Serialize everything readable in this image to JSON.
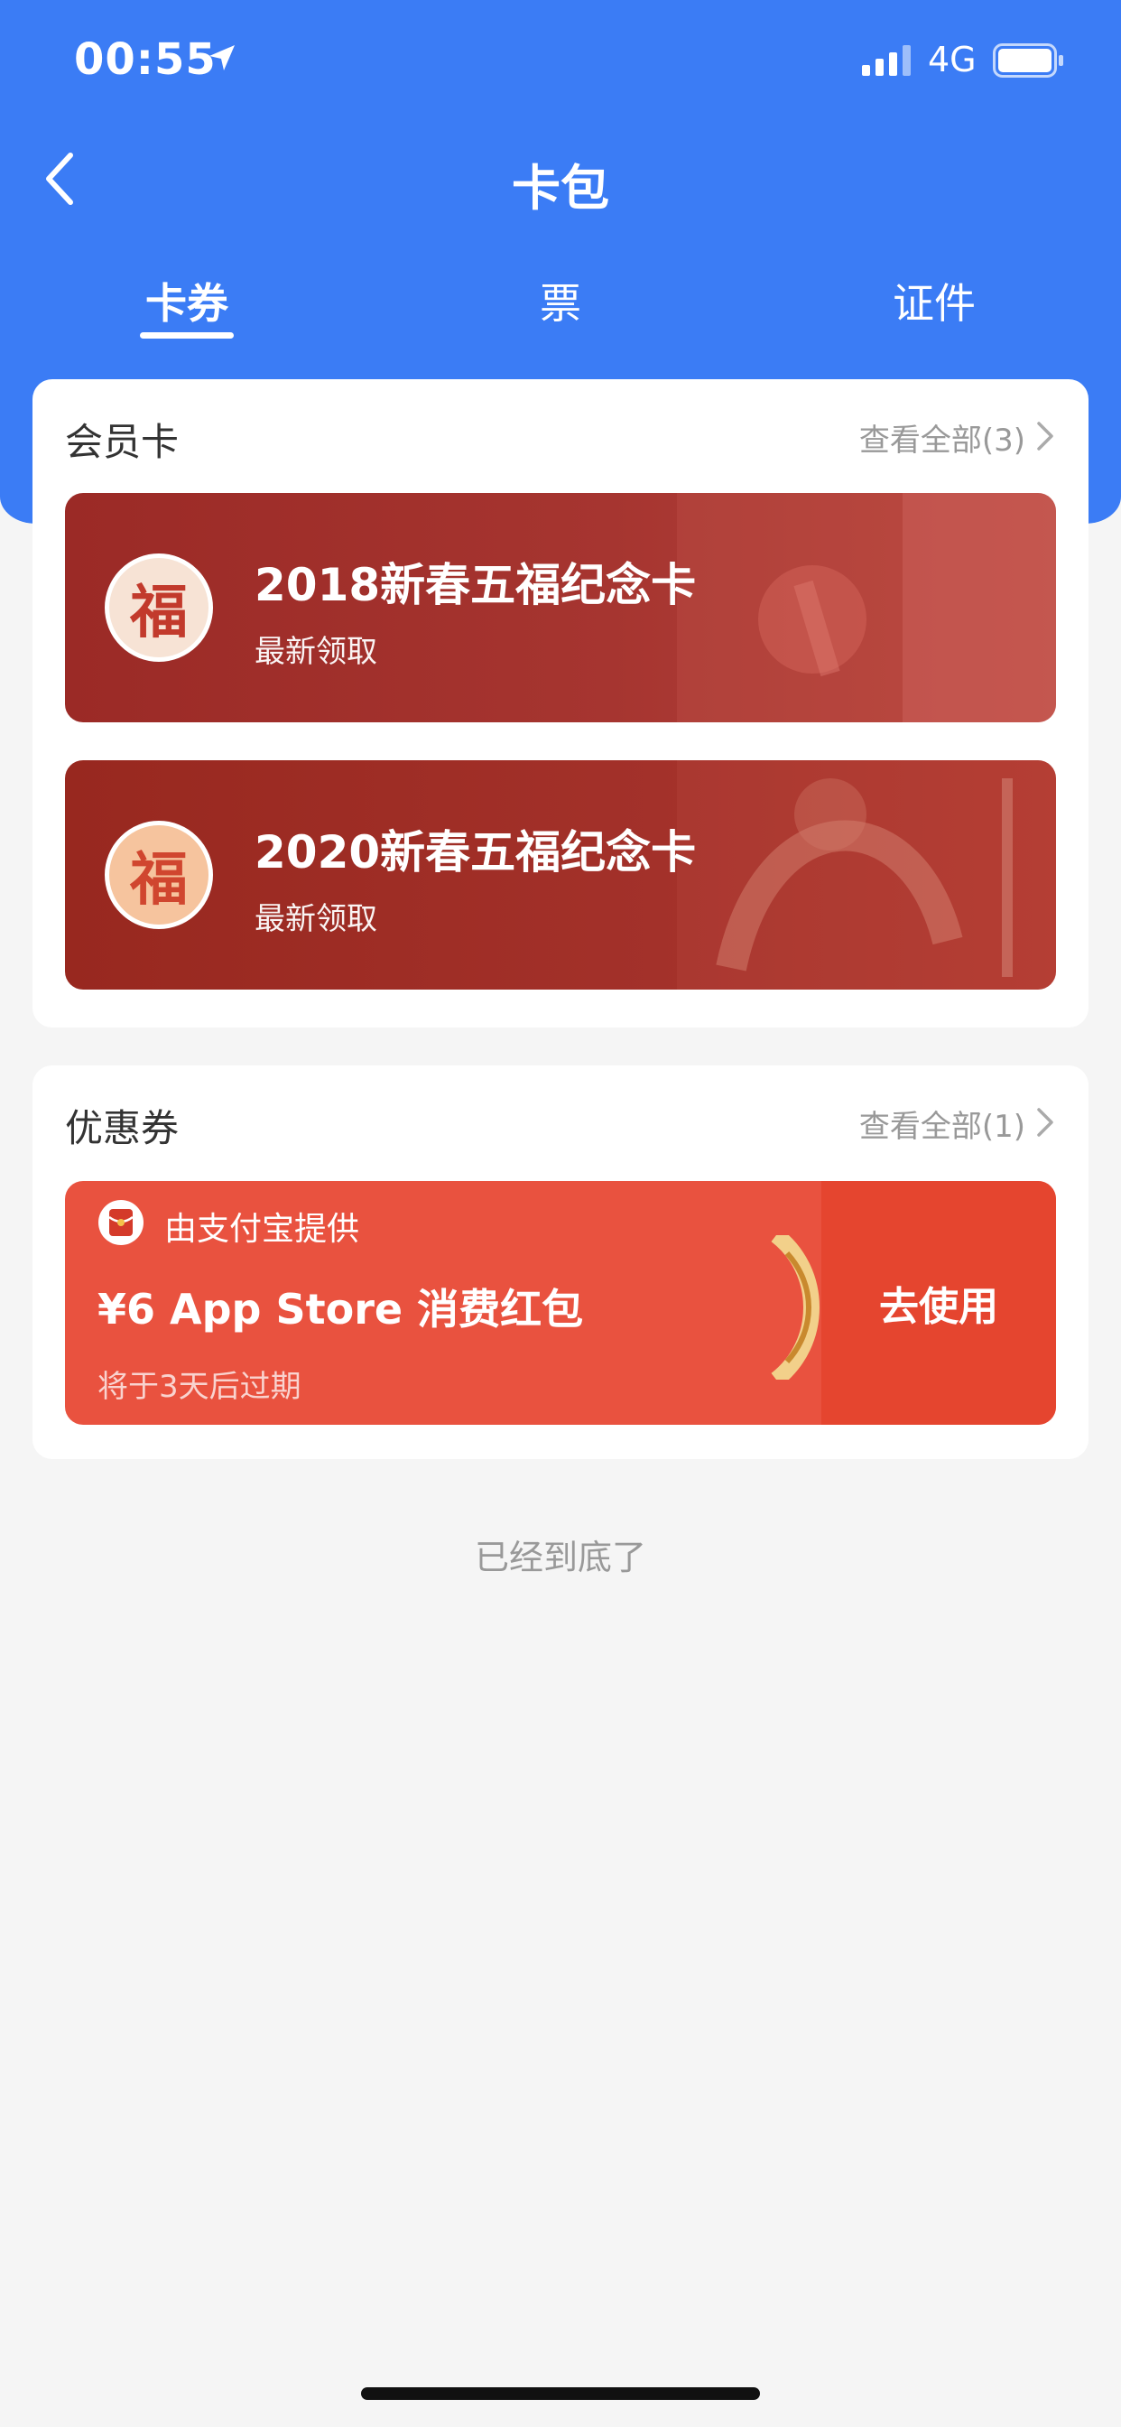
{
  "status_bar": {
    "time": "00:55",
    "network": "4G"
  },
  "nav": {
    "title": "卡包"
  },
  "tabs": [
    {
      "label": "卡券",
      "active": true
    },
    {
      "label": "票",
      "active": false
    },
    {
      "label": "证件",
      "active": false
    }
  ],
  "membership": {
    "title": "会员卡",
    "more": "查看全部(3)",
    "cards": [
      {
        "name": "2018新春五福纪念卡",
        "sub": "最新领取",
        "badge": "福",
        "color": "#9b2a26"
      },
      {
        "name": "2020新春五福纪念卡",
        "sub": "最新领取",
        "badge": "福",
        "color": "#98281f"
      }
    ]
  },
  "coupons": {
    "title": "优惠券",
    "more": "查看全部(1)",
    "item": {
      "provider": "由支付宝提供",
      "title": "¥6 App Store 消费红包",
      "expire": "将于3天后过期",
      "action": "去使用",
      "color": "#e9523f"
    }
  },
  "footer": {
    "text": "已经到底了"
  },
  "colors": {
    "primary": "#3b7cf5",
    "background": "#f5f5f5"
  }
}
